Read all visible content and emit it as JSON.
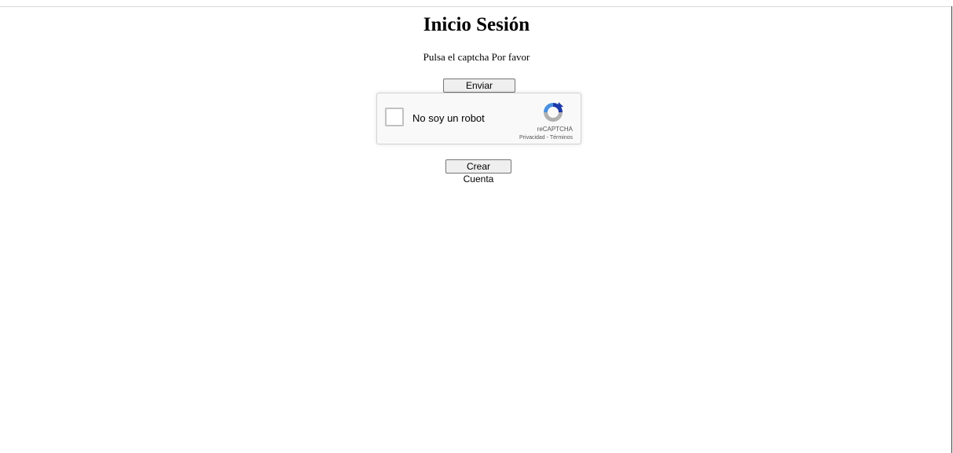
{
  "page": {
    "title": "Inicio Sesión",
    "prompt": "Pulsa el captcha Por favor"
  },
  "actions": {
    "send_captcha_label": "Enviar Captcha",
    "create_account_label": "Crear Cuenta"
  },
  "recaptcha": {
    "checkbox_label": "No soy un robot",
    "brand": "reCAPTCHA",
    "privacy_label": "Privacidad",
    "separator": " - ",
    "terms_label": "Términos",
    "checked": false,
    "colors": {
      "logo_blue_dark": "#1c3aa9",
      "logo_blue_light": "#4a90e2",
      "logo_gray": "#b0b0b0"
    }
  }
}
